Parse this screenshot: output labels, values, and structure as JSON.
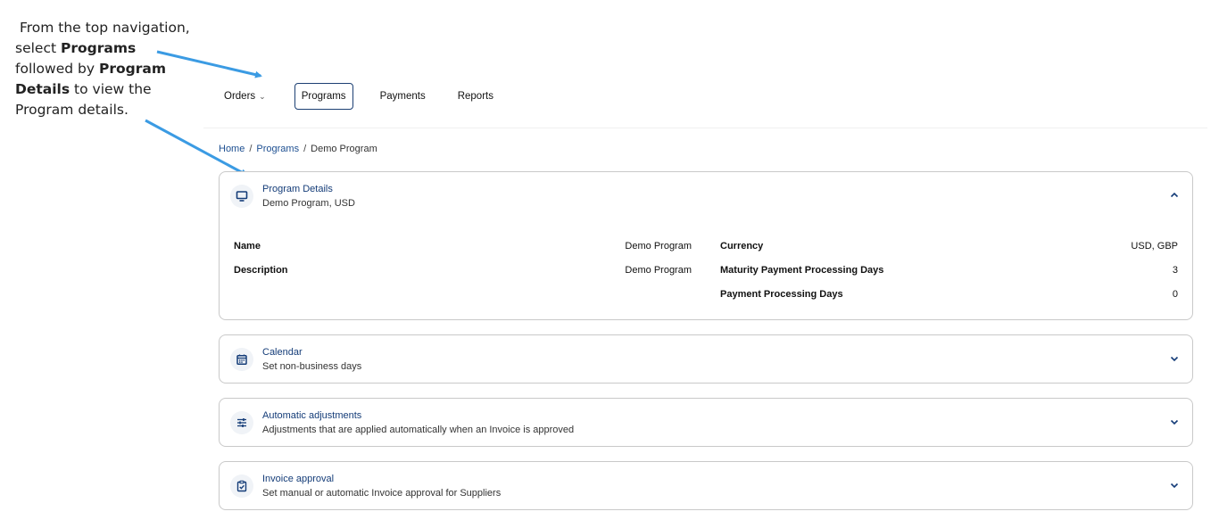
{
  "annotation": {
    "line1": "From the top navigation,",
    "line2_pre": "select ",
    "line2_bold": "Programs",
    "line3_pre": "followed by ",
    "line3_bold": "Program",
    "line4_bold": "Details",
    "line4_post": " to view the",
    "line5": "Program details."
  },
  "nav": {
    "orders": "Orders",
    "programs": "Programs",
    "payments": "Payments",
    "reports": "Reports"
  },
  "breadcrumb": {
    "home": "Home",
    "programs": "Programs",
    "current": "Demo Program",
    "separator": "/"
  },
  "cards": {
    "program_details": {
      "title": "Program Details",
      "subtitle": "Demo Program, USD",
      "icon": "monitor-icon",
      "expanded": true,
      "fields": {
        "name_label": "Name",
        "name_value": "Demo Program",
        "description_label": "Description",
        "description_value": "Demo Program",
        "currency_label": "Currency",
        "currency_value": "USD, GBP",
        "maturity_label": "Maturity Payment Processing Days",
        "maturity_value": "3",
        "processing_label": "Payment Processing Days",
        "processing_value": "0"
      }
    },
    "calendar": {
      "title": "Calendar",
      "subtitle": "Set non-business days",
      "icon": "calendar-icon",
      "expanded": false
    },
    "automatic_adjustments": {
      "title": "Automatic adjustments",
      "subtitle": "Adjustments that are applied automatically when an Invoice is approved",
      "icon": "sliders-icon",
      "expanded": false
    },
    "invoice_approval": {
      "title": "Invoice approval",
      "subtitle": "Set manual or automatic Invoice approval for Suppliers",
      "icon": "clipboard-check-icon",
      "expanded": false
    }
  },
  "colors": {
    "accent": "#143c78",
    "arrow": "#3b9be3",
    "border": "#c9c9c9"
  }
}
